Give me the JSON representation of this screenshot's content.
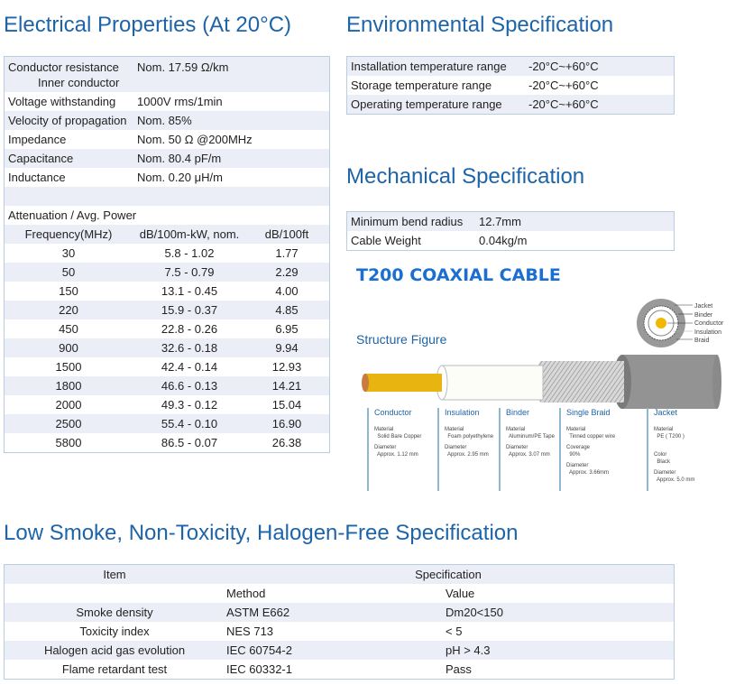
{
  "electrical": {
    "title": "Electrical Properties (At 20°C)",
    "rows": [
      {
        "label": "Conductor resistance",
        "sub": "Inner conductor",
        "value": "Nom. 17.59 Ω/km"
      },
      {
        "label": "Voltage withstanding",
        "value": "1000V rms/1min"
      },
      {
        "label": "Velocity of propagation",
        "value": "Nom. 85%"
      },
      {
        "label": "Impedance",
        "value": "Nom. 50 Ω @200MHz"
      },
      {
        "label": "Capacitance",
        "value": "Nom. 80.4 pF/m"
      },
      {
        "label": "Inductance",
        "value": "Nom. 0.20 μH/m"
      }
    ],
    "attenuation_title": "Attenuation / Avg. Power",
    "headers": [
      "Frequency(MHz)",
      "dB/100m-kW, nom.",
      "dB/100ft"
    ],
    "attenuation": [
      [
        "30",
        "5.8 - 1.02",
        "1.77"
      ],
      [
        "50",
        "7.5 - 0.79",
        "2.29"
      ],
      [
        "150",
        "13.1 - 0.45",
        "4.00"
      ],
      [
        "220",
        "15.9 - 0.37",
        "4.85"
      ],
      [
        "450",
        "22.8 - 0.26",
        "6.95"
      ],
      [
        "900",
        "32.6 - 0.18",
        "9.94"
      ],
      [
        "1500",
        "42.4 - 0.14",
        "12.93"
      ],
      [
        "1800",
        "46.6 - 0.13",
        "14.21"
      ],
      [
        "2000",
        "49.3 - 0.12",
        "15.04"
      ],
      [
        "2500",
        "55.4 - 0.10",
        "16.90"
      ],
      [
        "5800",
        "86.5 - 0.07",
        "26.38"
      ]
    ]
  },
  "environmental": {
    "title": "Environmental Specification",
    "rows": [
      {
        "label": "Installation temperature range",
        "value": "-20°C~+60°C"
      },
      {
        "label": "Storage temperature range",
        "value": "-20°C~+60°C"
      },
      {
        "label": "Operating temperature range",
        "value": "-20°C~+60°C"
      }
    ]
  },
  "mechanical": {
    "title": "Mechanical Specification",
    "rows": [
      {
        "label": "Minimum bend radius",
        "value": "12.7mm"
      },
      {
        "label": "Cable Weight",
        "value": "0.04kg/m"
      }
    ]
  },
  "figure": {
    "title": "T200 COAXIAL CABLE",
    "subtitle": "Structure Figure",
    "cross_labels": [
      "Jacket",
      "Binder",
      "Conductor",
      "Insulation",
      "Braid"
    ],
    "columns": [
      {
        "name": "Conductor",
        "lines": [
          "Material",
          "  Solid Bare Copper",
          "",
          "Diameter",
          "  Approx. 1.12 mm"
        ]
      },
      {
        "name": "Insulation",
        "lines": [
          "Material",
          "  Foam polyethylene",
          "",
          "Diameter",
          "  Approx. 2.95 mm"
        ]
      },
      {
        "name": "Binder",
        "lines": [
          "Material",
          "  Aluminum/PE Tape",
          "",
          "Diameter",
          "  Approx. 3.07 mm"
        ]
      },
      {
        "name": "Single Braid",
        "lines": [
          "Material",
          "  Tinned copper wire",
          "",
          "Coverage",
          "  90%",
          "",
          "Diameter",
          "  Approx. 3.66mm"
        ]
      },
      {
        "name": "Jacket",
        "lines": [
          "Material",
          "  PE ( T200 )",
          "",
          "",
          "",
          "Color",
          "  Black",
          "",
          "Diameter",
          "  Approx. 5.0 mm"
        ]
      }
    ]
  },
  "lszh": {
    "title": "Low Smoke, Non-Toxicity, Halogen-Free Specification",
    "header": {
      "item": "Item",
      "spec": "Specification"
    },
    "subheader": {
      "method": "Method",
      "value": "Value"
    },
    "rows": [
      [
        "Smoke density",
        "ASTM E662",
        "Dm20<150"
      ],
      [
        "Toxicity index",
        "NES 713",
        "< 5"
      ],
      [
        "Halogen acid gas evolution",
        "IEC 60754-2",
        "pH > 4.3"
      ],
      [
        "Flame retardant test",
        "IEC 60332-1",
        "Pass"
      ]
    ]
  }
}
